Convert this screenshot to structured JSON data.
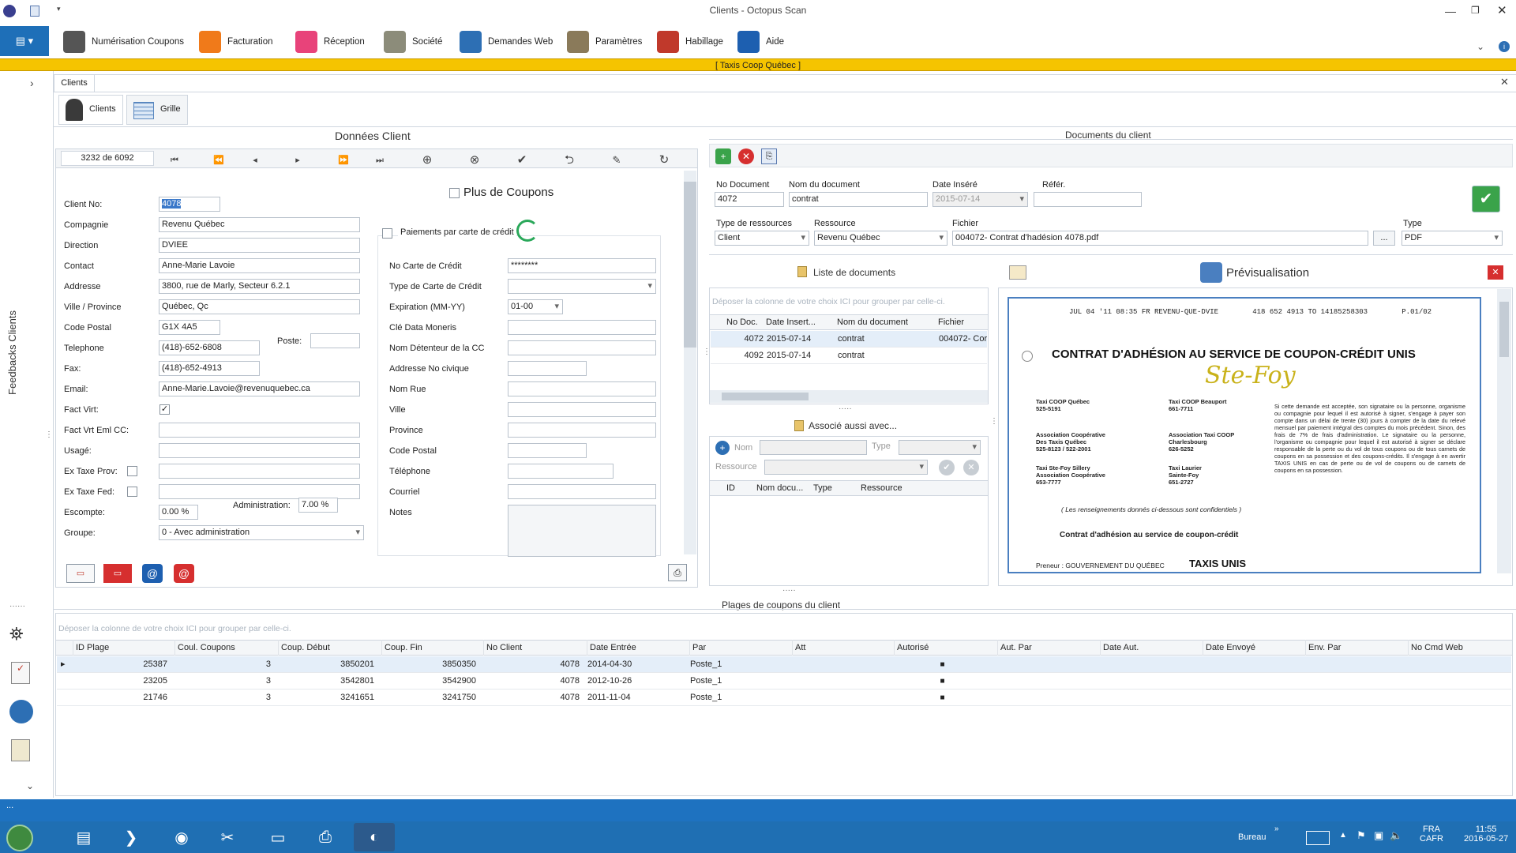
{
  "window": {
    "title": "Clients - Octopus Scan",
    "company": "[  Taxis Coop Québec  ]"
  },
  "ribbon": [
    {
      "label": "Numérisation Coupons",
      "icon": "scanner-icon",
      "color": "#555"
    },
    {
      "label": "Facturation",
      "icon": "invoice-icon",
      "color": "#f07a1a"
    },
    {
      "label": "Réception",
      "icon": "house-icon",
      "color": "#e8437a"
    },
    {
      "label": "Société",
      "icon": "building-icon",
      "color": "#8c8c7a"
    },
    {
      "label": "Demandes Web",
      "icon": "globe-icon",
      "color": "#2d6fb4"
    },
    {
      "label": "Paramètres",
      "icon": "tools-icon",
      "color": "#8a7a5a"
    },
    {
      "label": "Habillage",
      "icon": "palette-icon",
      "color": "#c0392b"
    },
    {
      "label": "Aide",
      "icon": "help-icon",
      "color": "#1d5fb0"
    }
  ],
  "tabs": {
    "main": "Clients",
    "sub1": "Clients",
    "sub2": "Grille",
    "feedback": "Feedbacks Clients"
  },
  "client": {
    "title": "Données Client",
    "record": "3232 de 6092",
    "plus_coupons": "Plus de Coupons",
    "fields": [
      {
        "label": "Client No:",
        "value": "4078"
      },
      {
        "label": "Compagnie",
        "value": "Revenu Québec"
      },
      {
        "label": "Direction",
        "value": "DVIEE"
      },
      {
        "label": "Contact",
        "value": "Anne-Marie Lavoie"
      },
      {
        "label": "Addresse",
        "value": "3800, rue de Marly, Secteur 6.2.1"
      },
      {
        "label": "Ville / Province",
        "value": "Québec, Qc"
      },
      {
        "label": "Code Postal",
        "value": "G1X 4A5"
      },
      {
        "label": "Telephone",
        "value": "(418)-652-6808"
      },
      {
        "label": "Fax:",
        "value": "(418)-652-4913"
      },
      {
        "label": "Email:",
        "value": "Anne-Marie.Lavoie@revenuquebec.ca"
      },
      {
        "label": "Fact Virt:",
        "value": ""
      },
      {
        "label": "Fact Vrt Eml CC:",
        "value": ""
      },
      {
        "label": "Usagé:",
        "value": ""
      },
      {
        "label": "Ex Taxe Prov:",
        "value": ""
      },
      {
        "label": "Ex Taxe Fed:",
        "value": ""
      },
      {
        "label": "Escompte:",
        "value": "0.00 %"
      },
      {
        "label": "Groupe:",
        "value": "0 - Avec administration"
      }
    ],
    "poste_label": "Poste:",
    "admin_label": "Administration:",
    "admin_value": "7.00 %"
  },
  "cc": {
    "title": "Paiements par carte de crédit",
    "fields": [
      {
        "label": "No Carte de Crédit",
        "value": "********"
      },
      {
        "label": "Type de Carte de Crédit",
        "value": ""
      },
      {
        "label": "Expiration (MM-YY)",
        "value": "01-00"
      },
      {
        "label": "Clé Data Moneris",
        "value": ""
      },
      {
        "label": "Nom Détenteur de la CC",
        "value": ""
      },
      {
        "label": "Addresse No civique",
        "value": ""
      },
      {
        "label": "Nom Rue",
        "value": ""
      },
      {
        "label": "Ville",
        "value": ""
      },
      {
        "label": "Province",
        "value": ""
      },
      {
        "label": "Code Postal",
        "value": ""
      },
      {
        "label": "Téléphone",
        "value": ""
      },
      {
        "label": "Courriel",
        "value": ""
      },
      {
        "label": "Notes",
        "value": ""
      }
    ]
  },
  "docs": {
    "title": "Documents du client",
    "labels": {
      "no": "No Document",
      "nom": "Nom du document",
      "date": "Date Inséré",
      "ref": "Référ.",
      "type_res": "Type de ressources",
      "res": "Ressource",
      "fichier": "Fichier",
      "type": "Type"
    },
    "values": {
      "no": "4072",
      "nom": "contrat",
      "date": "2015-07-14",
      "ref": "",
      "type_res": "Client",
      "res": "Revenu Québec",
      "fichier": "004072- Contrat d'hadésion 4078.pdf",
      "type": "PDF"
    },
    "list_title": "Liste de documents",
    "group_hint": "Déposer la colonne de votre choix ICI pour grouper par celle-ci.",
    "cols": [
      "No Doc.",
      "Date Insert...",
      "Nom du document",
      "Fichier"
    ],
    "rows": [
      [
        "4072",
        "2015-07-14",
        "contrat",
        "004072- Cor"
      ],
      [
        "4092",
        "2015-07-14",
        "contrat",
        ""
      ]
    ],
    "assoc_title": "Associé aussi avec...",
    "assoc_labels": {
      "nom": "Nom",
      "type": "Type",
      "res": "Ressource"
    },
    "assoc_cols": [
      "ID",
      "Nom docu...",
      "Type",
      "Ressource"
    ],
    "preview_title": "Prévisualisation"
  },
  "preview": {
    "fax": "JUL 04 '11 08:35 FR REVENU-QUE-DVIE        418 652 4913 TO 14185258303        P.01/02",
    "heading": "CONTRAT D'ADHÉSION AU SERVICE DE COUPON-CRÉDIT UNIS",
    "script": "Ste-Foy",
    "left_blocks": [
      "Taxi COOP Québec\n525-5191",
      "Association Coopérative\nDes Taxis Québec\n525-8123 / 522-2001",
      "Taxi Ste-Foy Sillery\nAssociation Coopérative\n653-7777"
    ],
    "mid_blocks": [
      "Taxi COOP Beauport\n661-7711",
      "Association Taxi COOP\nCharlesbourg\n626-5252",
      "Taxi Laurier\nSainte-Foy\n651-2727"
    ],
    "note": "( Les renseignements donnés ci-dessous sont confidentiels )",
    "sub": "Contrat d'adhésion au service de coupon-crédit",
    "preneur": "Preneur :   GOUVERNEMENT DU QUÉBEC",
    "taxis": "TAXIS UNIS",
    "body": "Si cette demande est acceptée, son signataire ou la personne, organisme ou compagnie pour lequel il est autorisé à signer, s'engage à payer son compte dans un délai de trente (30) jours à compter de la date du relevé mensuel par paiement intégral des comptes du mois précédent. Sinon, des frais de 7% de frais d'administration. Le signataire ou la personne, l'organisme ou compagnie pour lequel il est autorisé à signer se déclare responsable de la perte ou du vol de tous coupons ou de tous carnets de coupons en sa possession et des coupons-crédits. Il s'engage à en avertir TAXIS UNIS en cas de perte ou de vol de coupons ou de carnets de coupons en sa possession."
  },
  "plages": {
    "title": "Plages de coupons du client",
    "hint": "Déposer la colonne de votre choix ICI pour grouper par celle-ci.",
    "cols": [
      "ID Plage",
      "Coul. Coupons",
      "Coup. Début",
      "Coup. Fin",
      "No Client",
      "Date Entrée",
      "Par",
      "Att",
      "Autorisé",
      "Aut. Par",
      "Date Aut.",
      "Date Envoyé",
      "Env. Par",
      "No Cmd Web"
    ],
    "rows": [
      [
        "25387",
        "3",
        "3850201",
        "3850350",
        "4078",
        "2014-04-30",
        "Poste_1",
        "",
        "■",
        "",
        "",
        "",
        "",
        ""
      ],
      [
        "23205",
        "3",
        "3542801",
        "3542900",
        "4078",
        "2012-10-26",
        "Poste_1",
        "",
        "■",
        "",
        "",
        "",
        "",
        ""
      ],
      [
        "21746",
        "3",
        "3241651",
        "3241750",
        "4078",
        "2011-11-04",
        "Poste_1",
        "",
        "■",
        "",
        "",
        "",
        "",
        ""
      ]
    ]
  },
  "taskbar": {
    "bureau": "Bureau",
    "lang1": "FRA",
    "lang2": "CAFR",
    "time": "11:55",
    "date": "2016-05-27",
    "dots": "..."
  }
}
